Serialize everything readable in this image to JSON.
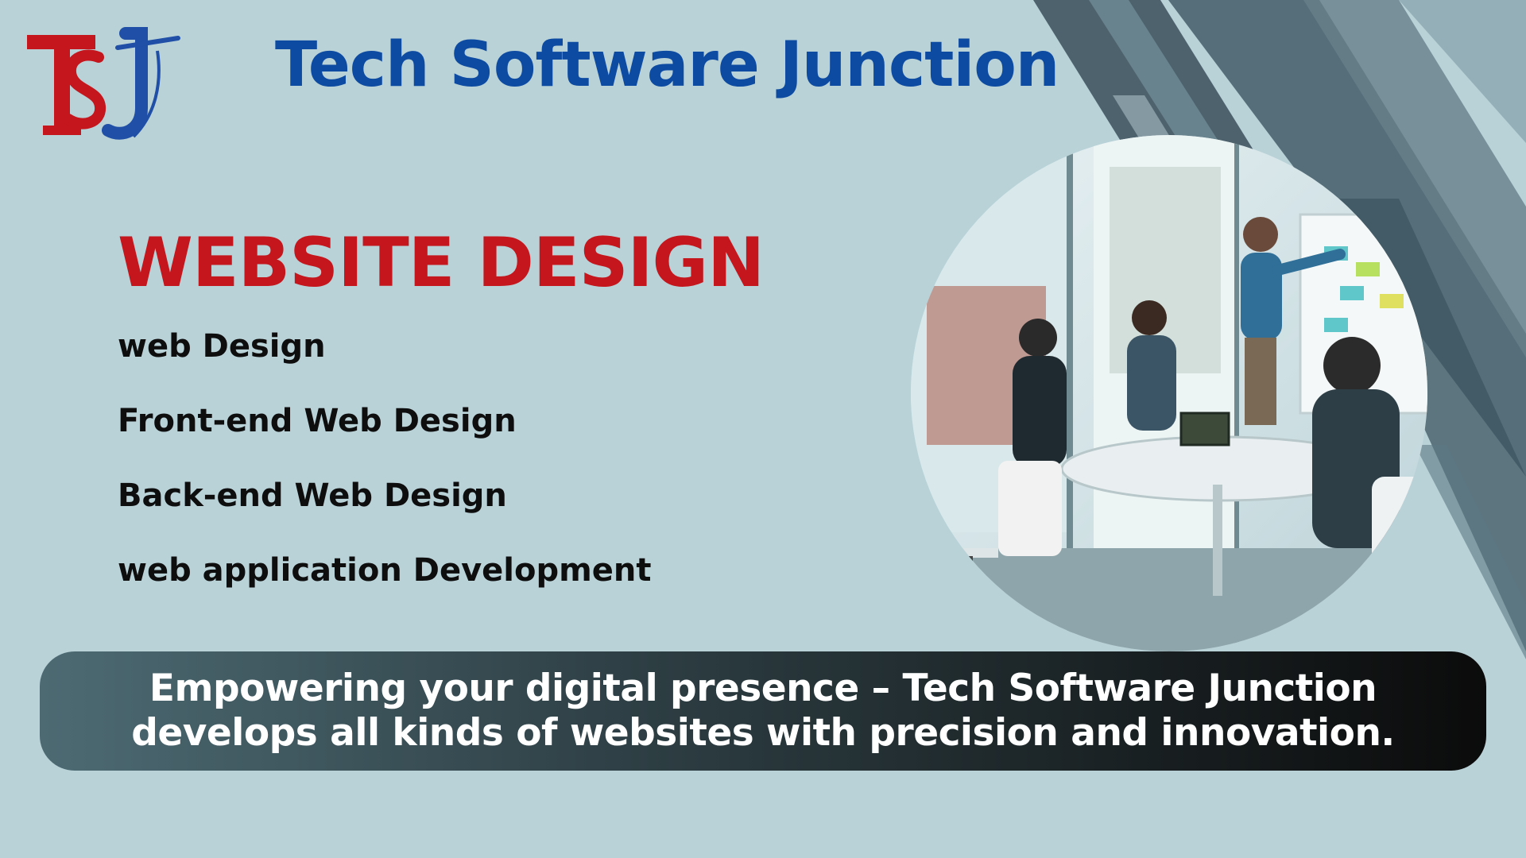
{
  "brand": {
    "name": "Tech Software Junction",
    "logo_text": "TSJ",
    "logo_icon": "tsj-monogram-logo"
  },
  "heading": "WEBSITE DESIGN",
  "services": [
    "web Design",
    "Front-end Web Design",
    "Back-end Web Design",
    "web application Development"
  ],
  "photo": {
    "icon": "team-meeting-photo"
  },
  "tagline": "Empowering your digital presence – Tech Software Junction develops all kinds of websites with precision and innovation.",
  "colors": {
    "background": "#b9d2d8",
    "brand_blue": "#0d4aa1",
    "heading_red": "#c4161c",
    "text_dark": "#0e0e0e",
    "banner_start": "#4d6a73",
    "banner_end": "#0b0b0b",
    "banner_text": "#ffffff"
  }
}
